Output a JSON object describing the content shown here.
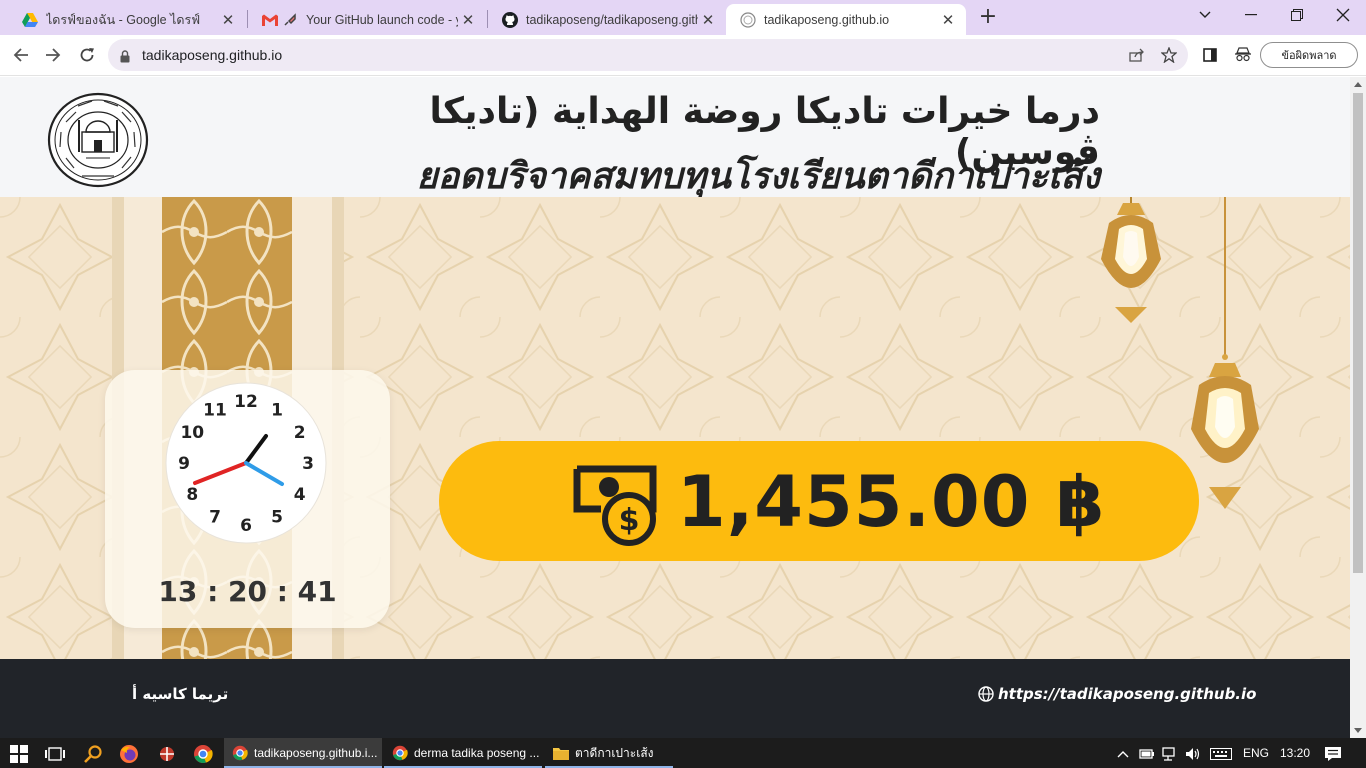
{
  "browser": {
    "tabs": [
      {
        "title": "ไดรฟ์ของฉัน - Google ไดรฟ์",
        "icon": "google-drive-icon",
        "active": false
      },
      {
        "title": "Your GitHub launch code - yo",
        "icon": "gmail-icon",
        "active": false
      },
      {
        "title": "tadikaposeng/tadikaposeng.github",
        "icon": "github-icon",
        "active": false
      },
      {
        "title": "tadikaposeng.github.io",
        "icon": "site-icon",
        "active": true
      }
    ],
    "new_tab": "+",
    "url": "tadikaposeng.github.io",
    "error_button": "ข้อผิดพลาด"
  },
  "page": {
    "title_arabic": "درما خيرات تاديكا روضة الهداية (تاديكا ڤوسين)",
    "title_thai": "ยอดบริจาคสมทบทุนโรงเรียนตาดีกาเปาะเส้ง",
    "clock": {
      "numbers": [
        "12",
        "1",
        "2",
        "3",
        "4",
        "5",
        "6",
        "7",
        "8",
        "9",
        "10",
        "11"
      ],
      "digital_time": "13 : 20 : 41"
    },
    "donation_amount": "1,455.00 ฿",
    "footer_left": "تريما كاسيه أ",
    "footer_link": "https://tadikaposeng.github.io"
  },
  "taskbar": {
    "windows": [
      {
        "title": "tadikaposeng.github.i...",
        "icon": "chrome-icon",
        "active": true
      },
      {
        "title": "derma tadika poseng ...",
        "icon": "chrome-icon",
        "active": false
      },
      {
        "title": "ตาดีกาเปาะเส้ง",
        "icon": "folder-icon",
        "active": false
      }
    ],
    "language": "ENG",
    "time": "13:20"
  },
  "colors": {
    "tab_strip": "#e4d6f5",
    "accent_yellow": "#fdbb0e",
    "footer": "#212429",
    "hero_bg": "#f4e5cd"
  }
}
